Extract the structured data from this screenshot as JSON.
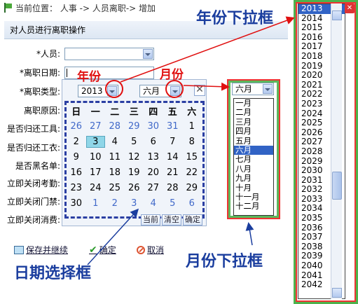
{
  "breadcrumb": "当前位置： 人事  -> 人员离职-> 增加",
  "section_title": "对人员进行离职操作",
  "form": {
    "labels": [
      "*人员:",
      "*离职日期:",
      "*离职类型:",
      "离职原因:",
      "是否归还工具:",
      "是否归还工衣:",
      "是否黑名单:",
      "立即关闭考勤:",
      "立即关闭门禁:",
      "立即关闭消费:"
    ]
  },
  "calendar": {
    "year": "2013",
    "month": "六月",
    "weekdays": [
      "日",
      "一",
      "二",
      "三",
      "四",
      "五",
      "六"
    ],
    "weeks": [
      [
        "26",
        "27",
        "28",
        "29",
        "30",
        "31",
        "1"
      ],
      [
        "2",
        "3",
        "4",
        "5",
        "6",
        "7",
        "8"
      ],
      [
        "9",
        "10",
        "11",
        "12",
        "13",
        "14",
        "15"
      ],
      [
        "16",
        "17",
        "18",
        "19",
        "20",
        "21",
        "22"
      ],
      [
        "23",
        "24",
        "25",
        "26",
        "27",
        "28",
        "29"
      ],
      [
        "30",
        "1",
        "2",
        "3",
        "4",
        "5",
        "6"
      ]
    ],
    "selected_day": "3",
    "buttons": {
      "today": "当前",
      "clear": "清空",
      "ok": "确定"
    },
    "close": "✕"
  },
  "month_dropdown": {
    "value": "六月",
    "options": [
      "一月",
      "二月",
      "三月",
      "四月",
      "五月",
      "六月",
      "七月",
      "八月",
      "九月",
      "十月",
      "十一月",
      "十二月"
    ],
    "highlighted": "六月"
  },
  "year_dropdown": {
    "options": [
      "2013",
      "2014",
      "2015",
      "2016",
      "2017",
      "2018",
      "2019",
      "2020",
      "2021",
      "2022",
      "2023",
      "2024",
      "2025",
      "2026",
      "2027",
      "2028",
      "2029",
      "2030",
      "2031",
      "2032",
      "2033",
      "2034",
      "2035",
      "2036",
      "2037",
      "2038",
      "2039",
      "2040",
      "2041",
      "2042"
    ],
    "highlighted": "2013"
  },
  "buttons": {
    "save_continue": "保存并继续",
    "confirm": "确定",
    "cancel": "取消"
  },
  "annotations": {
    "year_dropdown": "年份下拉框",
    "year": "年份",
    "month": "月份",
    "month_dropdown": "月份下拉框",
    "date_picker": "日期选择框"
  }
}
